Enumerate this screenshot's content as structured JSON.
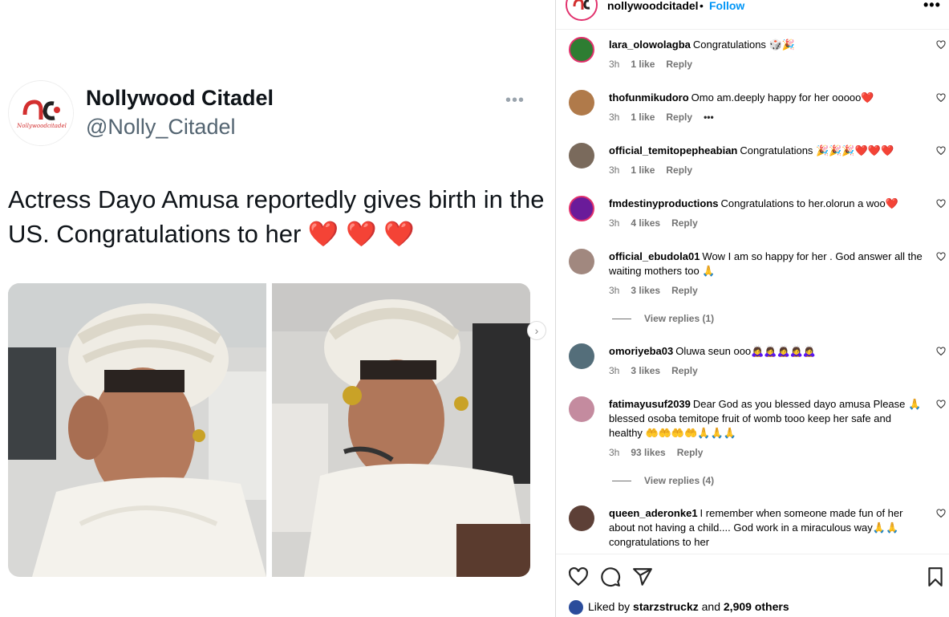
{
  "tweet": {
    "name": "Nollywood Citadel",
    "handle": "@Nolly_Citadel",
    "more": "•••",
    "text": "Actress Dayo Amusa reportedly gives birth in the US. Congratulations to her ❤️ ❤️ ❤️",
    "logo_text": "Nollywoodcitadel",
    "next": "›"
  },
  "post": {
    "username": "nollywoodcitadel",
    "dot": "•",
    "follow": "Follow",
    "more": "•••"
  },
  "comments": [
    {
      "user": "lara_olowolagba",
      "text": "Congratulations 🎲🎉",
      "time": "3h",
      "likes": "1 like",
      "reply": "Reply",
      "avatar_color": "#2e7d32"
    },
    {
      "user": "thofunmikudoro",
      "text": "Omo am.deeply happy for her ooooo❤️",
      "time": "3h",
      "likes": "1 like",
      "reply": "Reply",
      "extra": "•••",
      "avatar_color": "#b07a4a"
    },
    {
      "user": "official_temitopepheabian",
      "text": "Congratulations 🎉🎉🎉❤️❤️❤️",
      "time": "3h",
      "likes": "1 like",
      "reply": "Reply",
      "avatar_color": "#7a6a5c"
    },
    {
      "user": "fmdestinyproductions",
      "text": "Congratulations to her.olorun a woo❤️",
      "time": "3h",
      "likes": "4 likes",
      "reply": "Reply",
      "avatar_color": "#6a1b9a"
    },
    {
      "user": "official_ebudola01",
      "text": "Wow I am so happy for her . God answer all the waiting mothers too 🙏",
      "time": "3h",
      "likes": "3 likes",
      "reply": "Reply",
      "view_replies": "View replies (1)",
      "avatar_color": "#a1887f"
    },
    {
      "user": "omoriyeba03",
      "text": "Oluwa seun ooo🙇‍♀️🙇‍♀️🙇‍♀️🙇‍♀️🙇‍♀️",
      "time": "3h",
      "likes": "3 likes",
      "reply": "Reply",
      "avatar_color": "#546e7a"
    },
    {
      "user": "fatimayusuf2039",
      "text": "Dear God as you blessed dayo amusa Please 🙏blessed osoba temitope fruit of womb tooo keep her safe and healthy 🤲🤲🤲🤲🙏🙏🙏",
      "time": "3h",
      "likes": "93 likes",
      "reply": "Reply",
      "view_replies": "View replies (4)",
      "avatar_color": "#c48b9f"
    },
    {
      "user": "queen_aderonke1",
      "text": "I remember when someone made fun of her about not having a child.... God work in a miraculous way🙏🙏 congratulations to her",
      "avatar_color": "#5d4037"
    }
  ],
  "likes_line": {
    "prefix": "Liked by",
    "user": "starzstruckz",
    "and": "and",
    "count": "2,909 others"
  }
}
